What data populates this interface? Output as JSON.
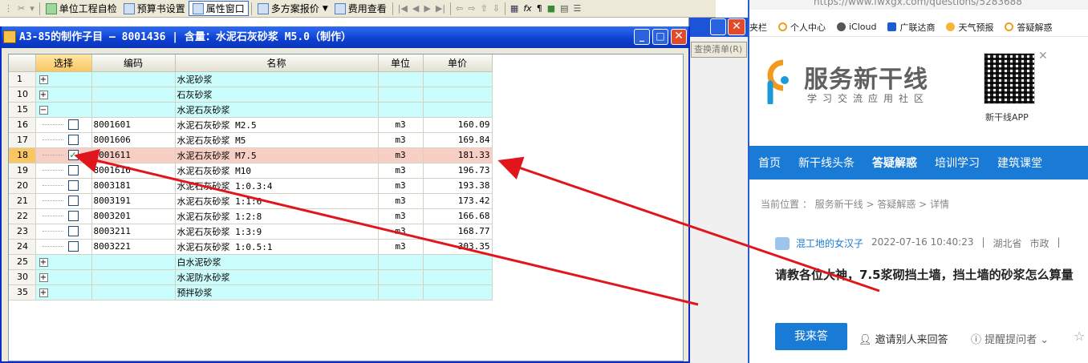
{
  "toolbar": {
    "items": [
      "单位工程自检",
      "预算书设置",
      "属性窗口",
      "多方案报价",
      "费用查看"
    ]
  },
  "bg_window": {
    "button_label": "查换清单(R)",
    "close_label": "✕"
  },
  "dialog": {
    "title": "A3-85的制作子目 — 8001436 | 含量：水泥石灰砂浆 M5.0（制作）",
    "close_label": "✕",
    "columns": [
      "选择",
      "编码",
      "名称",
      "单位",
      "单价"
    ],
    "rows": [
      {
        "num": "1",
        "type": "group",
        "expander": "+",
        "name": "水泥砂浆"
      },
      {
        "num": "10",
        "type": "group",
        "expander": "+",
        "name": "石灰砂浆"
      },
      {
        "num": "15",
        "type": "group",
        "expander": "−",
        "name": "水泥石灰砂浆"
      },
      {
        "num": "16",
        "type": "item",
        "checked": false,
        "code": "8001601",
        "name": "水泥石灰砂浆 M2.5",
        "unit": "m3",
        "price": "160.09"
      },
      {
        "num": "17",
        "type": "item",
        "checked": false,
        "code": "8001606",
        "name": "水泥石灰砂浆 M5",
        "unit": "m3",
        "price": "169.84"
      },
      {
        "num": "18",
        "type": "item",
        "checked": true,
        "code": "8001611",
        "name": "水泥石灰砂浆 M7.5",
        "unit": "m3",
        "price": "181.33"
      },
      {
        "num": "19",
        "type": "item",
        "checked": false,
        "code": "8001616",
        "name": "水泥石灰砂浆 M10",
        "unit": "m3",
        "price": "196.73"
      },
      {
        "num": "20",
        "type": "item",
        "checked": false,
        "code": "8003181",
        "name": "水泥石灰砂浆 1:0.3:4",
        "unit": "m3",
        "price": "193.38"
      },
      {
        "num": "21",
        "type": "item",
        "checked": false,
        "code": "8003191",
        "name": "水泥石灰砂浆 1:1:6",
        "unit": "m3",
        "price": "173.42"
      },
      {
        "num": "22",
        "type": "item",
        "checked": false,
        "code": "8003201",
        "name": "水泥石灰砂浆 1:2:8",
        "unit": "m3",
        "price": "166.68"
      },
      {
        "num": "23",
        "type": "item",
        "checked": false,
        "code": "8003211",
        "name": "水泥石灰砂浆 1:3:9",
        "unit": "m3",
        "price": "168.77"
      },
      {
        "num": "24",
        "type": "item",
        "checked": false,
        "code": "8003221",
        "name": "水泥石灰砂浆 1:0.5:1",
        "unit": "m3",
        "price": "303.35"
      },
      {
        "num": "25",
        "type": "group",
        "expander": "+",
        "name": "白水泥砂浆"
      },
      {
        "num": "30",
        "type": "group",
        "expander": "+",
        "name": "水泥防水砂浆"
      },
      {
        "num": "35",
        "type": "group",
        "expander": "+",
        "name": "预拌砂浆"
      }
    ]
  },
  "browser": {
    "url": "https://www.fwxgx.com/questions/5283688",
    "bookmarks": [
      "夹栏",
      "个人中心",
      "iCloud",
      "广联达商",
      "天气预报",
      "答疑解惑"
    ],
    "site": {
      "logo_text": "服务新干线",
      "logo_sub": "学习交流应用社区",
      "qr_label": "新干线APP",
      "qr_close": "✕",
      "nav": [
        "首页",
        "新干线头条",
        "答疑解惑",
        "培训学习",
        "建筑课堂"
      ],
      "breadcrumb": "当前位置 ： 服务新干线 > 答疑解惑 > 详情",
      "author": "混工地的女汉子",
      "date": "2022-07-16 10:40:23",
      "separator": "|",
      "region": "湖北省",
      "category": "市政",
      "question": "请教各位大神，7.5浆砌挡土墙，挡土墙的砂浆怎么算量",
      "answer_button": "我来答",
      "invite": "邀请别人来回答",
      "remind": "提醒提问者",
      "star": "☆"
    }
  },
  "colors": {
    "group_row": "#ccfdfd",
    "checked_row": "#f7cfc5",
    "arrow": "#e0161c",
    "nav_bg": "#1a7bd6"
  }
}
